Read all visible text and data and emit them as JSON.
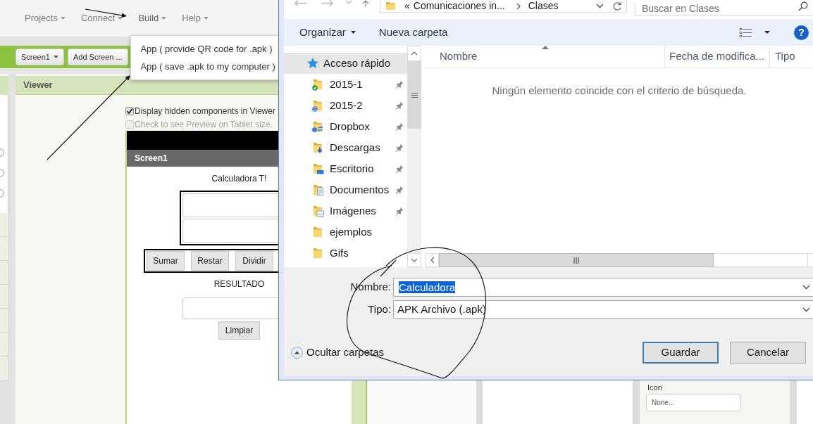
{
  "app_inventor": {
    "menu": [
      {
        "label": "Projects",
        "expanded": false
      },
      {
        "label": "Connect",
        "expanded": false
      },
      {
        "label": "Build",
        "expanded": true,
        "items": [
          "App ( provide QR code for .apk )",
          "App ( save .apk to my computer )"
        ]
      },
      {
        "label": "Help",
        "expanded": false
      }
    ],
    "toolbar": {
      "screen": "Screen1",
      "add_screen": "Add Screen ..."
    },
    "viewer": {
      "title": "Viewer",
      "options": [
        {
          "label": "Display hidden components in Viewer",
          "checked": true,
          "disabled": false
        },
        {
          "label": "Check to see Preview on Tablet size.",
          "checked": false,
          "disabled": true
        }
      ],
      "phone": {
        "title": "Screen1",
        "heading": "Calculadora T!",
        "buttons": [
          "Sumar",
          "Restar",
          "Dividir"
        ],
        "result_label": "RESULTADO",
        "clear_button": "Limpiar"
      }
    },
    "properties": {
      "label": "Icon",
      "value": "None..."
    }
  },
  "save_dialog": {
    "address": {
      "overflow_mark": "«",
      "path": [
        "Comunicaciones in...",
        "Clases"
      ]
    },
    "search": {
      "placeholder": "Buscar en Clases"
    },
    "toolbar": {
      "organize": "Organizar",
      "new_folder": "Nueva carpeta",
      "help": "?"
    },
    "navigation": [
      {
        "label": "Acceso rápido",
        "kind": "quick-access",
        "selected": true,
        "pinned": false
      },
      {
        "label": "2015-1",
        "kind": "synced",
        "selected": false,
        "pinned": true
      },
      {
        "label": "2015-2",
        "kind": "syncing",
        "selected": false,
        "pinned": true
      },
      {
        "label": "Dropbox",
        "kind": "linked",
        "selected": false,
        "pinned": true
      },
      {
        "label": "Descargas",
        "kind": "downloads",
        "selected": false,
        "pinned": true
      },
      {
        "label": "Escritorio",
        "kind": "desktop",
        "selected": false,
        "pinned": true
      },
      {
        "label": "Documentos",
        "kind": "documents",
        "selected": false,
        "pinned": true
      },
      {
        "label": "Imágenes",
        "kind": "pictures",
        "selected": false,
        "pinned": true
      },
      {
        "label": "ejemplos",
        "kind": "folder",
        "selected": false,
        "pinned": false
      },
      {
        "label": "Gifs",
        "kind": "folder",
        "selected": false,
        "pinned": false
      }
    ],
    "columns": [
      {
        "label": "Nombre",
        "sorted": true
      },
      {
        "label": "Fecha de modifica...",
        "sorted": false
      },
      {
        "label": "Tipo",
        "sorted": false
      }
    ],
    "empty_message": "Ningún elemento coincide con el criterio de búsqueda.",
    "filename": {
      "label": "Nombre:",
      "value": "Calculadora",
      "selected": true
    },
    "file_type": {
      "label": "Tipo:",
      "value": "APK Archivo (.apk)"
    },
    "hide_folders": "Ocultar carpetas",
    "buttons": [
      {
        "label": "Guardar",
        "default": true
      },
      {
        "label": "Cancelar",
        "default": false
      }
    ]
  }
}
